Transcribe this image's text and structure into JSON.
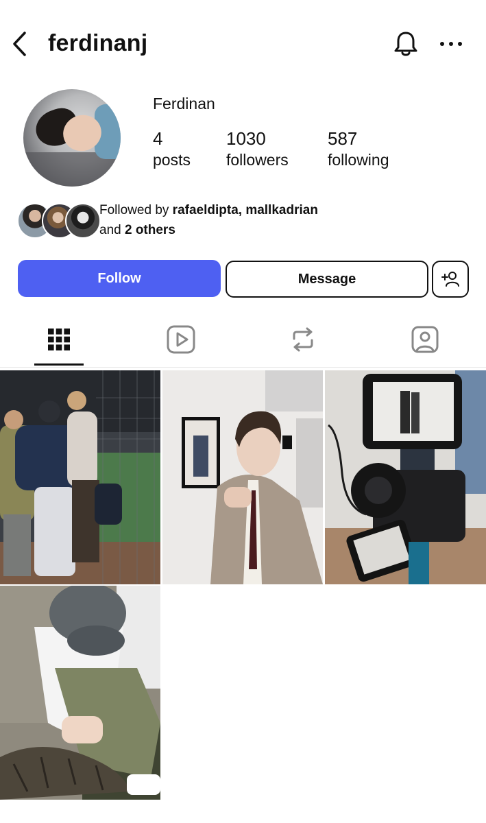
{
  "header": {
    "username": "ferdinanj",
    "back_icon": "chevron-left-icon",
    "bell_icon": "bell-icon",
    "more_icon": "more-horizontal-icon"
  },
  "profile": {
    "display_name": "Ferdinan",
    "stats": [
      {
        "value": "4",
        "label": "posts"
      },
      {
        "value": "1030",
        "label": "followers"
      },
      {
        "value": "587",
        "label": "following"
      }
    ]
  },
  "followed_by": {
    "prefix": "Followed by ",
    "names": "rafaeldipta, mallkadrian",
    "and_text": "and ",
    "others": "2 others"
  },
  "actions": {
    "follow_label": "Follow",
    "message_label": "Message",
    "add_user_icon": "add-user-icon",
    "follow_color": "#4e60f2"
  },
  "tabs": [
    {
      "name": "posts-grid",
      "icon": "grid-icon",
      "active": true
    },
    {
      "name": "reels",
      "icon": "play-icon",
      "active": false
    },
    {
      "name": "reposts",
      "icon": "repost-icon",
      "active": false
    },
    {
      "name": "tagged",
      "icon": "tagged-person-icon",
      "active": false
    }
  ],
  "posts": [
    {
      "name": "post-friends-walking"
    },
    {
      "name": "post-suit-portrait"
    },
    {
      "name": "post-camera-monitor"
    },
    {
      "name": "post-petting-cat"
    }
  ]
}
